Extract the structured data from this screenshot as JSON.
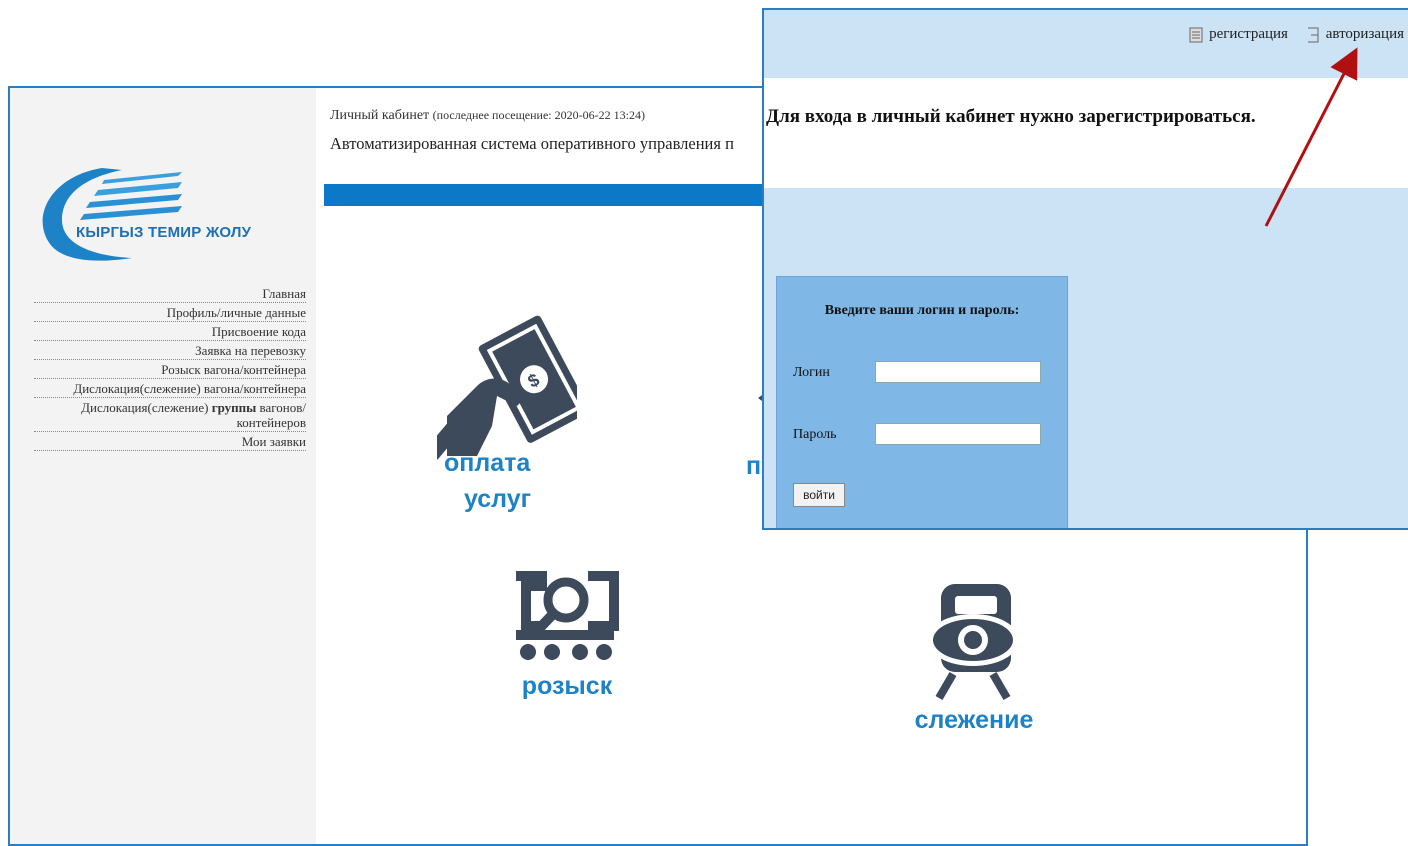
{
  "portal": {
    "logo_text": "КЫРГЫЗ ТЕМИР ЖОЛУ",
    "menu": [
      {
        "label": "Главная"
      },
      {
        "label": "Профиль/личные данные"
      },
      {
        "label": "Присвоение кода"
      },
      {
        "label": "Заявка на перевозку"
      },
      {
        "label": "Розыск вагона/контейнера"
      },
      {
        "label": "Дислокация(слежение) вагона/контейнера"
      },
      {
        "label_pre": "Дислокация(слежение) ",
        "label_bold": "группы",
        "label_post": " вагонов/ контейнеров"
      },
      {
        "label": "Мои заявки"
      }
    ],
    "last_visit_label": "Личный кабинет",
    "last_visit_value": "(последнее посещение: 2020-06-22 13:24)",
    "system_title": "Автоматизированная система оперативного управления п",
    "tiles": {
      "pay": {
        "line1": "оплата",
        "line2": "услуг",
        "icon": "hand-money-icon"
      },
      "search": {
        "label": "розыск",
        "icon": "wagon-search-icon"
      },
      "track": {
        "label": "слежение",
        "icon": "train-eye-icon"
      },
      "partial_letter": "п"
    }
  },
  "overlay": {
    "top_links": {
      "register": {
        "label": "регистрация",
        "icon": "document-icon"
      },
      "login": {
        "label": "авторизация",
        "icon": "sign-in-icon"
      }
    },
    "notice": "Для входа в личный кабинет нужно зарегистрироваться.",
    "login_form": {
      "title": "Введите ваши логин и пароль:",
      "login_label": "Логин",
      "login_value": "",
      "password_label": "Пароль",
      "password_value": "",
      "submit_label": "войти"
    }
  },
  "colors": {
    "brand_blue": "#1d82c6",
    "bar_blue": "#0b78c8",
    "icon_dark": "#3d4a5c",
    "overlay_bg": "#cce3f5",
    "panel_bg": "#7fb7e6",
    "arrow": "#b01010"
  }
}
